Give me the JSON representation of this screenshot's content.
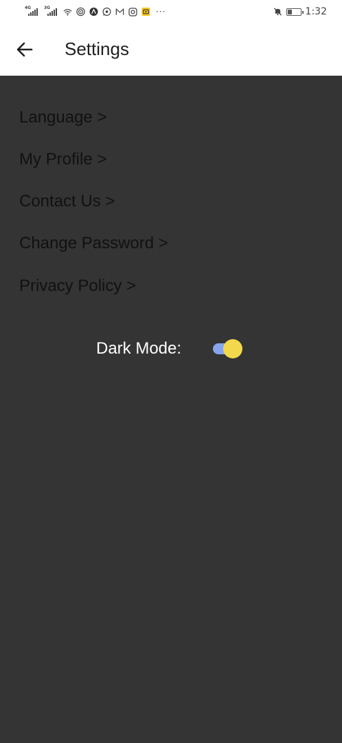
{
  "status_bar": {
    "signal1_label": "4G",
    "signal2_label": "3G",
    "icons": [
      "signal-icon",
      "signal-icon",
      "wifi-icon",
      "hotspot-icon",
      "app-a-icon",
      "whatsapp-icon",
      "gmail-icon",
      "instagram-icon",
      "notification-app-icon",
      "more-icon",
      "mute-icon",
      "battery-icon"
    ],
    "more": "···",
    "battery_level": 0.35,
    "time": "1:32"
  },
  "app_bar": {
    "title": "Settings",
    "back_icon": "arrow-left-icon"
  },
  "menu": {
    "items": [
      {
        "label": "Language >"
      },
      {
        "label": "My Profile >"
      },
      {
        "label": "Contact Us >"
      },
      {
        "label": "Change Password >"
      },
      {
        "label": "Privacy Policy >"
      }
    ]
  },
  "dark_mode": {
    "label": "Dark Mode:",
    "enabled": true
  },
  "colors": {
    "background": "#343434",
    "toggle_track": "#86a5ee",
    "toggle_thumb": "#f2d84a"
  }
}
